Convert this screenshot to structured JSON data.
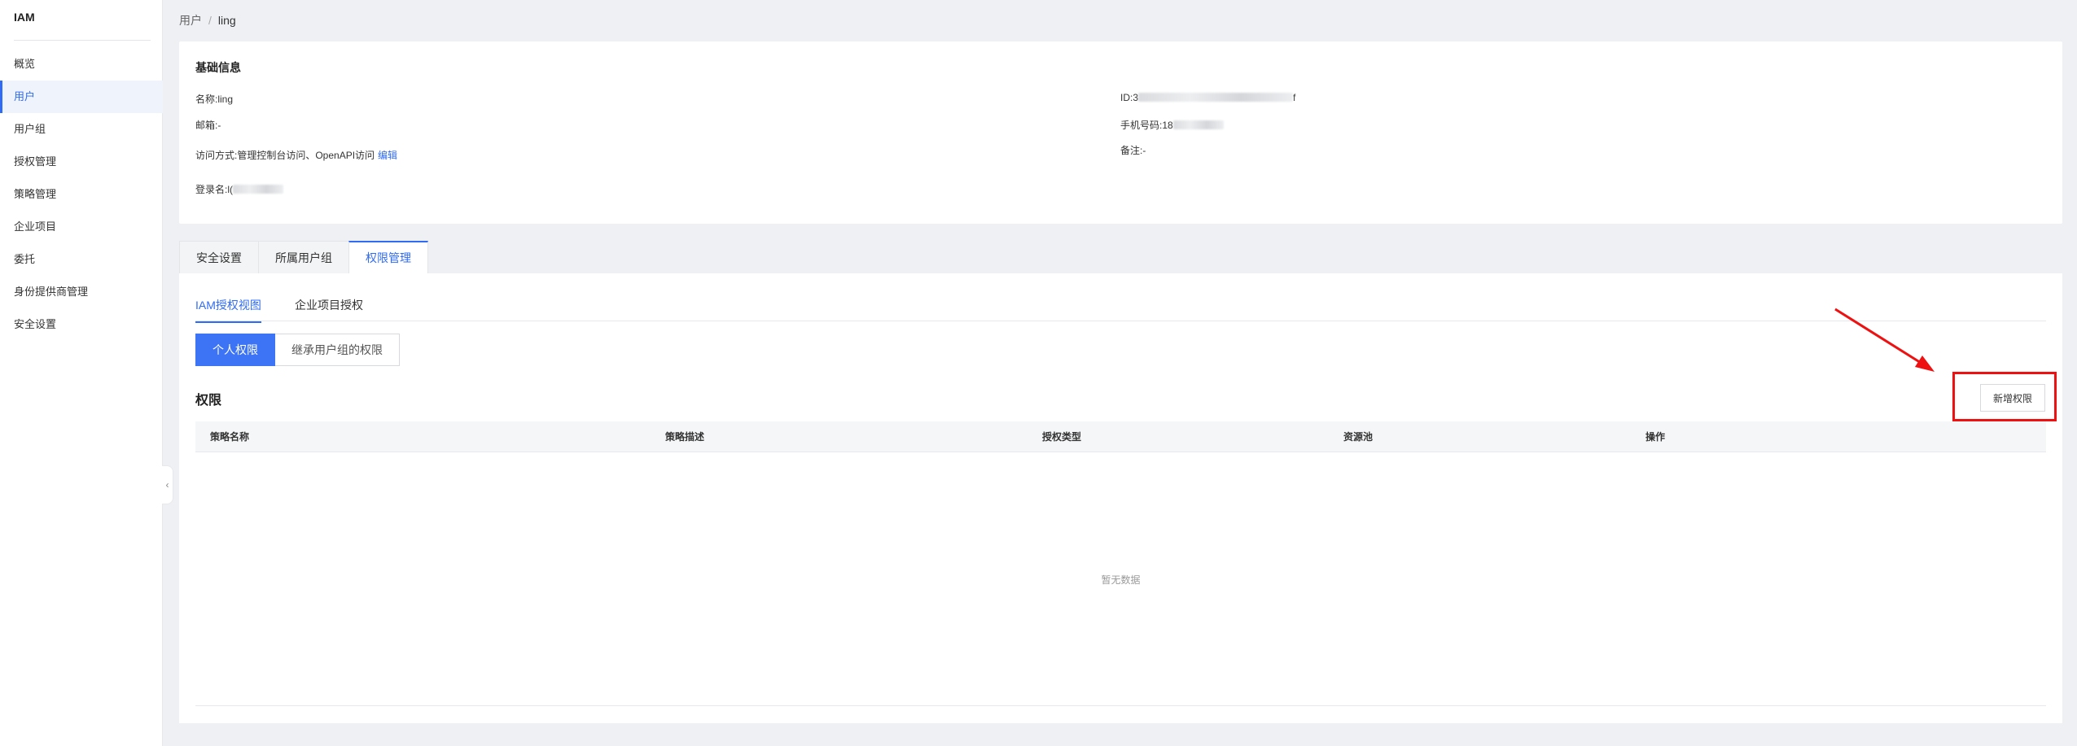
{
  "sidebar": {
    "brand": "IAM",
    "items": [
      {
        "label": "概览"
      },
      {
        "label": "用户"
      },
      {
        "label": "用户组"
      },
      {
        "label": "授权管理"
      },
      {
        "label": "策略管理"
      },
      {
        "label": "企业项目"
      },
      {
        "label": "委托"
      },
      {
        "label": "身份提供商管理"
      },
      {
        "label": "安全设置"
      }
    ],
    "active_index": 1
  },
  "breadcrumb": {
    "parent": "用户",
    "separator": "/",
    "current": "ling"
  },
  "basic_info": {
    "title": "基础信息",
    "name_label": "名称:",
    "name_value": "ling",
    "email_label": "邮箱:",
    "email_value": "-",
    "access_label": "访问方式:",
    "access_value": "管理控制台访问、OpenAPI访问",
    "access_edit": "编辑",
    "login_label": "登录名:",
    "login_value": "l(",
    "id_label": "ID:",
    "id_prefix": "3",
    "id_suffix": "f",
    "phone_label": "手机号码:",
    "phone_value": "18",
    "remark_label": "备注:",
    "remark_value": "-"
  },
  "tabs": [
    {
      "label": "安全设置"
    },
    {
      "label": "所属用户组"
    },
    {
      "label": "权限管理"
    }
  ],
  "subtabs": [
    {
      "label": "IAM授权视图"
    },
    {
      "label": "企业项目授权"
    }
  ],
  "segment": [
    {
      "label": "个人权限"
    },
    {
      "label": "继承用户组的权限"
    }
  ],
  "permissions": {
    "title": "权限",
    "add_button": "新增权限",
    "columns": [
      "策略名称",
      "策略描述",
      "授权类型",
      "资源池",
      "操作"
    ],
    "empty_text": "暂无数据"
  },
  "colors": {
    "accent": "#2f6bf5",
    "highlight": "#ee1111"
  },
  "icons": {
    "collapse": "chevron-left-icon"
  }
}
